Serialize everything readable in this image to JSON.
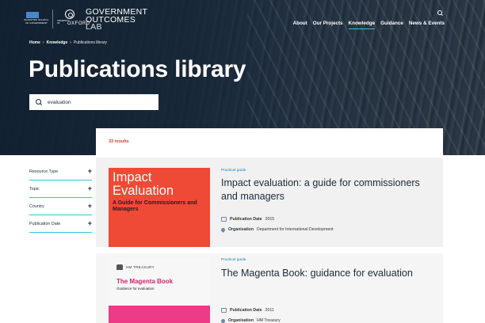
{
  "brand": {
    "crest_text": "BLAVATNIK SCHOOL OF GOVERNMENT",
    "university_small": "UNIVERSITY OF",
    "university_name": "OXFORD",
    "lab_line1": "GOVERNMENT",
    "lab_line2": "OUTCOMES",
    "lab_line3": "LAB"
  },
  "nav": {
    "items": [
      {
        "label": "About"
      },
      {
        "label": "Our Projects"
      },
      {
        "label": "Knowledge"
      },
      {
        "label": "Guidance"
      },
      {
        "label": "News & Events"
      }
    ],
    "active": "Knowledge"
  },
  "breadcrumb": {
    "items": [
      "Home",
      "Knowledge",
      "Publications library"
    ],
    "separator": "›"
  },
  "page_title": "Publications library",
  "search": {
    "value": "evaluation",
    "icon": "search-icon"
  },
  "results": {
    "count_text": "33 results",
    "items": [
      {
        "tag": "Practical guide",
        "title": "Impact evaluation: a guide for commissioners and managers",
        "date_label": "Publication Date",
        "date": "2015",
        "org_label": "Organisation",
        "org": "Department for International Development",
        "thumb_title": "Impact Evaluation",
        "thumb_sub": "A Guide for Commissioners and Managers",
        "thumb_color": "#ef4a36"
      },
      {
        "tag": "Practical guide",
        "title": "The Magenta Book: guidance for evaluation",
        "date_label": "Publication Date",
        "date": "2011",
        "org_label": "Organisation",
        "org": "HM Treasury",
        "thumb_header": "HM TREASURY",
        "thumb_title": "The Magenta Book",
        "thumb_sub": "Guidance for evaluation",
        "thumb_color": "#ec3c87"
      }
    ]
  },
  "filters": {
    "items": [
      {
        "label": "Resource Type",
        "icon": "plus-icon"
      },
      {
        "label": "Topic",
        "icon": "plus-icon"
      },
      {
        "label": "Country",
        "icon": "plus-icon"
      },
      {
        "label": "Publication Date",
        "icon": "plus-icon"
      }
    ]
  },
  "colors": {
    "accent": "#38c1d6",
    "results_count": "#d23c2a",
    "tag": "#1f7fb0",
    "hero_dark": "#112030"
  }
}
